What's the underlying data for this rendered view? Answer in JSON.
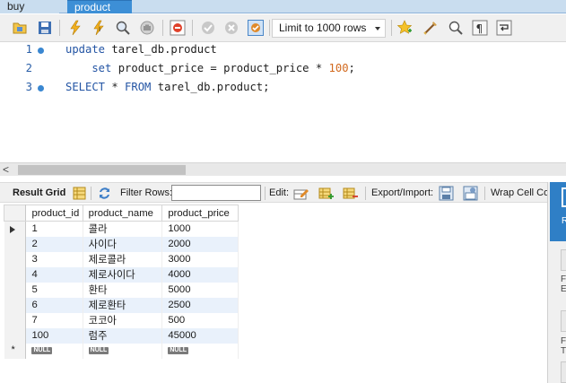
{
  "tabs": [
    {
      "label": "buy",
      "active": false
    },
    {
      "label": "product",
      "active": true
    }
  ],
  "toolbar": {
    "limit_select_value": "Limit to 1000 rows"
  },
  "editor": {
    "lines": [
      {
        "number": "1",
        "tokens": [
          {
            "t": "update",
            "c": "kw"
          },
          {
            "t": " tarel_db.product",
            "c": ""
          }
        ]
      },
      {
        "number": "2",
        "tokens": [
          {
            "t": "    set",
            "c": "kw"
          },
          {
            "t": " product_price = product_price * ",
            "c": ""
          },
          {
            "t": "100",
            "c": "num"
          },
          {
            "t": ";",
            "c": ""
          }
        ]
      },
      {
        "number": "3",
        "tokens": [
          {
            "t": "SELECT",
            "c": "kw"
          },
          {
            "t": " * ",
            "c": ""
          },
          {
            "t": "FROM",
            "c": "kw"
          },
          {
            "t": " tarel_db.product;",
            "c": ""
          }
        ]
      }
    ]
  },
  "result_toolbar": {
    "result_grid_label": "Result Grid",
    "filter_rows_label": "Filter Rows:",
    "filter_rows_value": "",
    "edit_label": "Edit:",
    "export_import_label": "Export/Import:",
    "wrap_cell_label": "Wrap Cell Con"
  },
  "grid": {
    "columns": [
      "product_id",
      "product_name",
      "product_price"
    ],
    "rows": [
      [
        "1",
        "콜라",
        "1000"
      ],
      [
        "2",
        "사이다",
        "2000"
      ],
      [
        "3",
        "제로콜라",
        "3000"
      ],
      [
        "4",
        "제로사이다",
        "4000"
      ],
      [
        "5",
        "환타",
        "5000"
      ],
      [
        "6",
        "제로환타",
        "2500"
      ],
      [
        "7",
        "코코아",
        "500"
      ],
      [
        "100",
        "럼주",
        "45000"
      ]
    ],
    "new_row_marker": "*",
    "null_label": "NULL"
  },
  "right_panel": {
    "tiles": [
      "R",
      "F",
      "E",
      "F",
      "T"
    ]
  },
  "colors": {
    "active_tab": "#3d8fd6",
    "keyword": "#2455a4",
    "number": "#d2691e",
    "alt_row": "#e9f1fb",
    "side_panel_accent": "#2f7fc6"
  }
}
